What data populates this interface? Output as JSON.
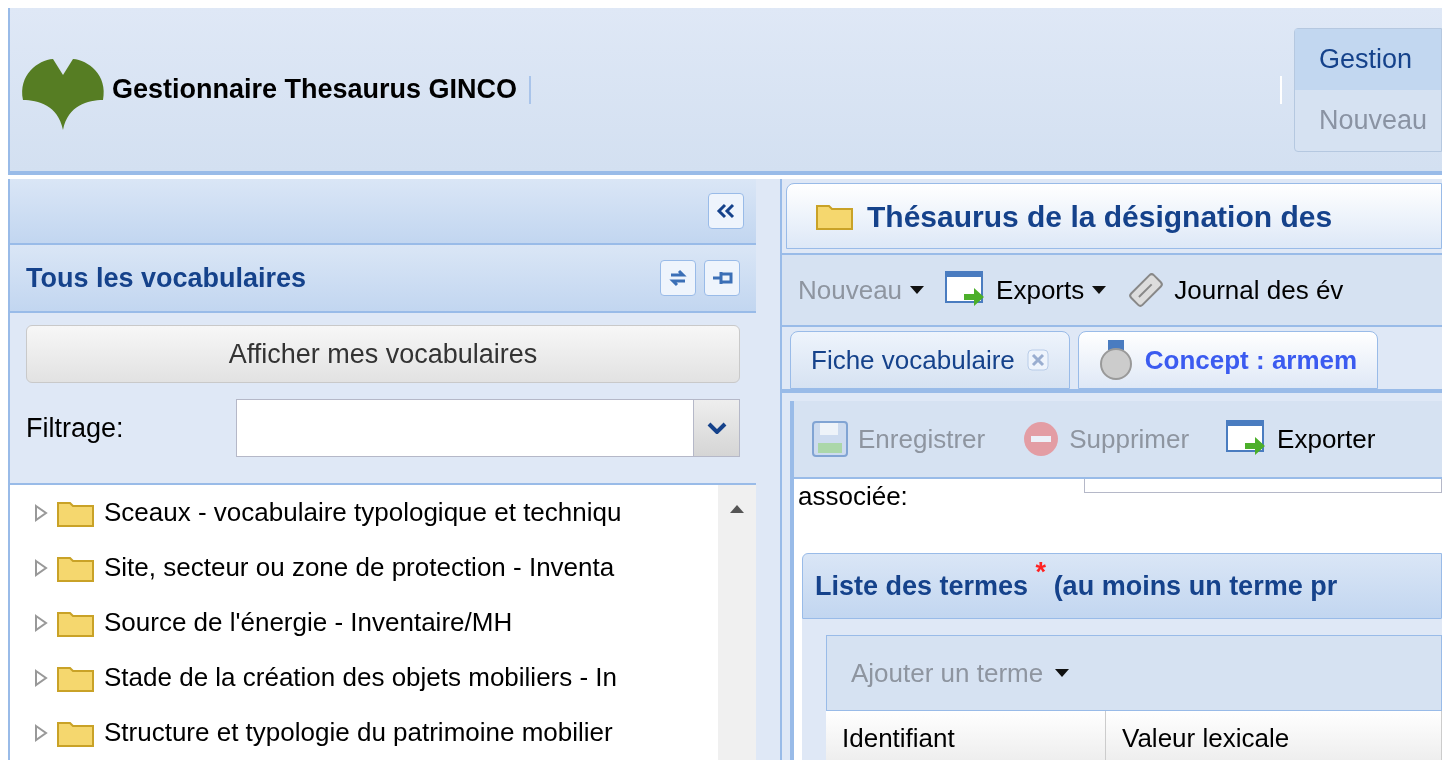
{
  "header": {
    "title": "Gestionnaire Thesaurus GINCO",
    "menu": [
      {
        "label": "Gestion",
        "selected": true
      },
      {
        "label": "Nouveau",
        "selected": false
      }
    ]
  },
  "left": {
    "title": "Tous les vocabulaires",
    "show_button": "Afficher mes vocabulaires",
    "filter_label": "Filtrage:",
    "tree": [
      {
        "label": "Sceaux - vocabulaire typologique et techniqu",
        "expanded": false
      },
      {
        "label": "Site, secteur ou zone de protection - Inventa",
        "expanded": false
      },
      {
        "label": "Source de l'énergie - Inventaire/MH",
        "expanded": false
      },
      {
        "label": "Stade de la création des objets mobiliers - In",
        "expanded": false
      },
      {
        "label": "Structure et typologie du patrimoine mobilier",
        "expanded": false
      }
    ]
  },
  "right": {
    "title": "Thésaurus de la désignation des",
    "toolbar": [
      {
        "kind": "menu",
        "label": "Nouveau",
        "disabled": true
      },
      {
        "kind": "export",
        "label": "Exports",
        "disabled": false
      },
      {
        "kind": "journal",
        "label": "Journal des év",
        "disabled": false
      }
    ],
    "tabs": [
      {
        "kind": "vocab",
        "label": "Fiche vocabulaire",
        "selected": false
      },
      {
        "kind": "concept",
        "label": "Concept : armem",
        "selected": true
      }
    ],
    "form_toolbar": [
      {
        "kind": "save",
        "label": "Enregistrer",
        "disabled": true
      },
      {
        "kind": "delete",
        "label": "Supprimer",
        "disabled": true
      },
      {
        "kind": "export",
        "label": "Exporter",
        "disabled": false
      }
    ],
    "field_label": "associée:",
    "section_title": "Liste des termes $^{*}$ (au moins un terme pr",
    "add_term": {
      "label": "Ajouter un terme",
      "disabled": true
    },
    "columns": [
      "Identifiant",
      "Valeur lexicale"
    ]
  }
}
